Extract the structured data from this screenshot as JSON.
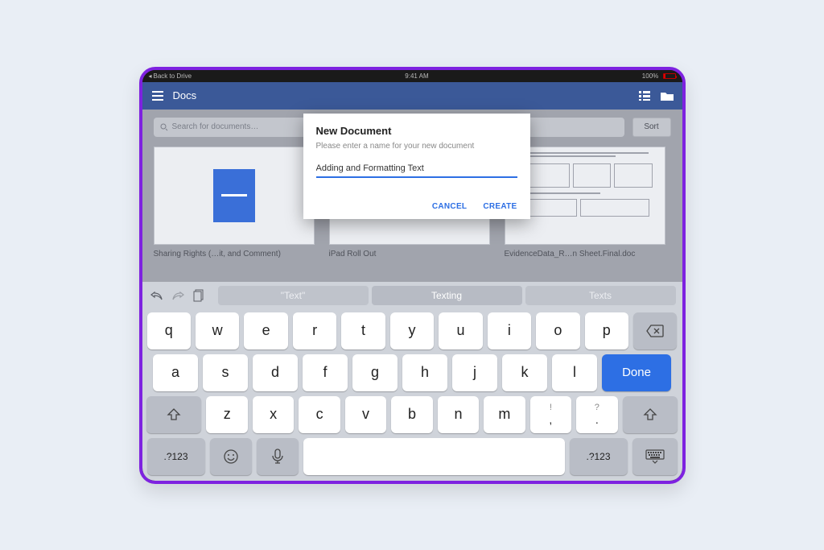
{
  "status": {
    "back": "Back to Drive",
    "time": "9:41 AM",
    "battery": "100%"
  },
  "app": {
    "title": "Docs"
  },
  "search": {
    "placeholder": "Search for documents…"
  },
  "sort": {
    "label": "Sort"
  },
  "docs": [
    {
      "title": "Sharing Rights (…it, and Comment)"
    },
    {
      "title": "iPad Roll Out"
    },
    {
      "title": "EvidenceData_R…n Sheet.Final.doc"
    }
  ],
  "dialog": {
    "title": "New Document",
    "subtitle": "Please enter a name for your new document",
    "value": "Adding and Formatting Text",
    "cancel": "CANCEL",
    "create": "CREATE"
  },
  "kb": {
    "suggestions": [
      "\"Text\"",
      "Texting",
      "Texts"
    ],
    "row1": [
      "q",
      "w",
      "e",
      "r",
      "t",
      "y",
      "u",
      "i",
      "o",
      "p"
    ],
    "row2": [
      "a",
      "s",
      "d",
      "f",
      "g",
      "h",
      "j",
      "k",
      "l"
    ],
    "row3": [
      "z",
      "x",
      "c",
      "v",
      "b",
      "n",
      "m"
    ],
    "punct": [
      {
        "top": "!",
        "main": ","
      },
      {
        "top": "?",
        "main": "."
      }
    ],
    "done": "Done",
    "numsym": ".?123"
  }
}
